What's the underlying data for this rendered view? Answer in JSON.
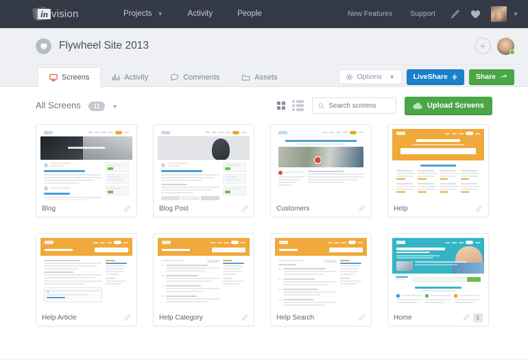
{
  "topnav": {
    "logo_in": "in",
    "logo_text": "vision",
    "links": [
      {
        "label": "Projects",
        "has_caret": true
      },
      {
        "label": "Activity",
        "has_caret": false
      },
      {
        "label": "People",
        "has_caret": false
      }
    ],
    "right_links": [
      {
        "label": "New Features"
      },
      {
        "label": "Support"
      }
    ],
    "icons": [
      {
        "name": "pen-signature-icon"
      },
      {
        "name": "heart-icon"
      }
    ],
    "avatar": {
      "name": "user-avatar"
    }
  },
  "project": {
    "icon": "screen-monitor-icon",
    "title": "Flywheel Site 2013",
    "add_member_label": "+",
    "member_status": "online"
  },
  "tabs": [
    {
      "label": "Screens",
      "icon": "monitor-icon",
      "active": true
    },
    {
      "label": "Activity",
      "icon": "bar-chart-icon",
      "active": false
    },
    {
      "label": "Comments",
      "icon": "speech-bubble-icon",
      "active": false
    },
    {
      "label": "Assets",
      "icon": "folder-icon",
      "active": false
    }
  ],
  "tab_actions": {
    "options_label": "Options",
    "liveshare_label": "LiveShare",
    "share_label": "Share"
  },
  "filterbar": {
    "all_screens_label": "All Screens",
    "count": "11",
    "view_grid": "grid-view-icon",
    "view_list": "list-view-icon",
    "search_placeholder": "Search screens",
    "search_value": "",
    "upload_label": "Upload Screens"
  },
  "colors": {
    "nav_bg": "#343a45",
    "page_bg": "#eef0f3",
    "accent_red": "#e8453c",
    "accent_blue": "#1b7fc9",
    "accent_green": "#4aa646",
    "accent_yellow": "#f0a93a",
    "accent_teal": "#35b4c6"
  },
  "screens": [
    {
      "name": "Blog",
      "hero": "photo",
      "hero_color": "#2e3338",
      "hero_text": "Behind the scenes",
      "badge": null,
      "comment_marker": false
    },
    {
      "name": "Blog Post",
      "hero": "photo",
      "hero_color": "#e2e4e7",
      "hero_text": "",
      "badge": null,
      "comment_marker": false
    },
    {
      "name": "Customers",
      "hero": "photo",
      "hero_color": "#c9cbbf",
      "hero_text": "Creative companies all over the world choose Flywheel",
      "badge": null,
      "comment_marker": true
    },
    {
      "name": "Help",
      "hero": "yellow",
      "hero_color": "#f0a93a",
      "hero_text": "How can we help?",
      "badge": null,
      "comment_marker": false
    },
    {
      "name": "Help Article",
      "hero": "yellow",
      "hero_color": "#f0a93a",
      "hero_text": "General Questions",
      "badge": null,
      "comment_marker": false
    },
    {
      "name": "Help Category",
      "hero": "yellow",
      "hero_color": "#f0a93a",
      "hero_text": "Getting Started",
      "badge": null,
      "comment_marker": false
    },
    {
      "name": "Help Search",
      "hero": "yellow",
      "hero_color": "#f0a93a",
      "hero_text": "Search",
      "badge": null,
      "comment_marker": false
    },
    {
      "name": "Home",
      "hero": "teal",
      "hero_color": "#35b4c6",
      "hero_text": "WordPress hosting you can love",
      "badge": "1",
      "comment_marker": false
    }
  ]
}
